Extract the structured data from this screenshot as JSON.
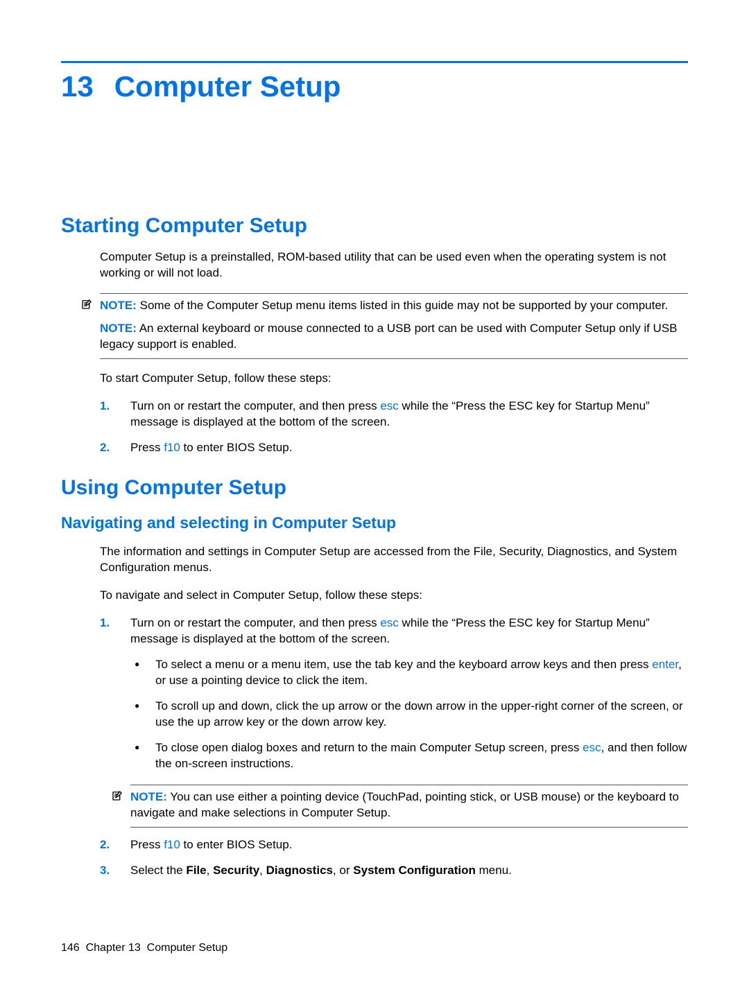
{
  "chapter": {
    "number": "13",
    "title": "Computer Setup"
  },
  "sections": {
    "starting": {
      "heading": "Starting Computer Setup",
      "intro": "Computer Setup is a preinstalled, ROM-based utility that can be used even when the operating system is not working or will not load.",
      "note1_label": "NOTE:",
      "note1": "Some of the Computer Setup menu items listed in this guide may not be supported by your computer.",
      "note2_label": "NOTE:",
      "note2": "An external keyboard or mouse connected to a USB port can be used with Computer Setup only if USB legacy support is enabled.",
      "lead": "To start Computer Setup, follow these steps:",
      "step1_num": "1.",
      "step1_a": "Turn on or restart the computer, and then press ",
      "step1_key": "esc",
      "step1_b": " while the “Press the ESC key for Startup Menu” message is displayed at the bottom of the screen.",
      "step2_num": "2.",
      "step2_a": "Press ",
      "step2_key": "f10",
      "step2_b": " to enter BIOS Setup."
    },
    "using": {
      "heading": "Using Computer Setup",
      "sub1": "Navigating and selecting in Computer Setup",
      "p1": "The information and settings in Computer Setup are accessed from the File, Security, Diagnostics, and System Configuration menus.",
      "p2": "To navigate and select in Computer Setup, follow these steps:",
      "step1_num": "1.",
      "step1_a": "Turn on or restart the computer, and then press ",
      "step1_key": "esc",
      "step1_b": " while the “Press the ESC key for Startup Menu” message is displayed at the bottom of the screen.",
      "b1_a": "To select a menu or a menu item, use the tab key and the keyboard arrow keys and then press ",
      "b1_key": "enter",
      "b1_b": ", or use a pointing device to click the item.",
      "b2": "To scroll up and down, click the up arrow or the down arrow in the upper-right corner of the screen, or use the up arrow key or the down arrow key.",
      "b3_a": "To close open dialog boxes and return to the main Computer Setup screen, press ",
      "b3_key": "esc",
      "b3_b": ", and then follow the on-screen instructions.",
      "note_label": "NOTE:",
      "note": "You can use either a pointing device (TouchPad, pointing stick, or USB mouse) or the keyboard to navigate and make selections in Computer Setup.",
      "step2_num": "2.",
      "step2_a": "Press ",
      "step2_key": "f10",
      "step2_b": " to enter BIOS Setup.",
      "step3_num": "3.",
      "step3_a": "Select the ",
      "step3_b1": "File",
      "step3_c1": ", ",
      "step3_b2": "Security",
      "step3_c2": ", ",
      "step3_b3": "Diagnostics",
      "step3_c3": ", or ",
      "step3_b4": "System Configuration",
      "step3_c4": " menu."
    }
  },
  "footer": {
    "page": "146",
    "chapter_label": "Chapter 13",
    "title": "Computer Setup"
  },
  "icons": {
    "note": "✍"
  }
}
